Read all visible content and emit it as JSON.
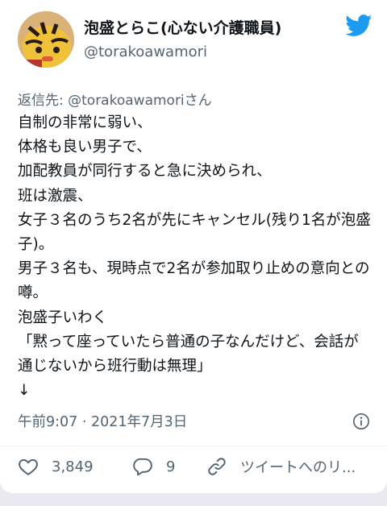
{
  "tweet": {
    "display_name": "泡盛とらこ(心ない介護職員)",
    "handle": "@torakoawamori",
    "reply_to": "返信先: @torakoawamoriさん",
    "text": "自制の非常に弱い、\n体格も良い男子で、\n加配教員が同行すると急に決められ、\n班は激震、\n女子３名のうち2名が先にキャンセル(残り1名が泡盛子)。\n男子３名も、現時点で2名が参加取り止めの意向との噂。\n泡盛子いわく\n「黙って座っていたら普通の子なんだけど、会話が通じないから班行動は無理」\n↓",
    "timestamp": "午前9:07 · 2021年7月3日"
  },
  "actions": {
    "likes": "3,849",
    "replies": "9",
    "link_label": "ツイートへのリ..."
  },
  "icons": {
    "logo": "twitter-bird-icon",
    "info": "info-icon",
    "like": "heart-icon",
    "reply": "reply-bubble-icon",
    "link": "link-icon"
  },
  "colors": {
    "twitter_blue": "#1d9bf0",
    "secondary_text": "#536471"
  }
}
